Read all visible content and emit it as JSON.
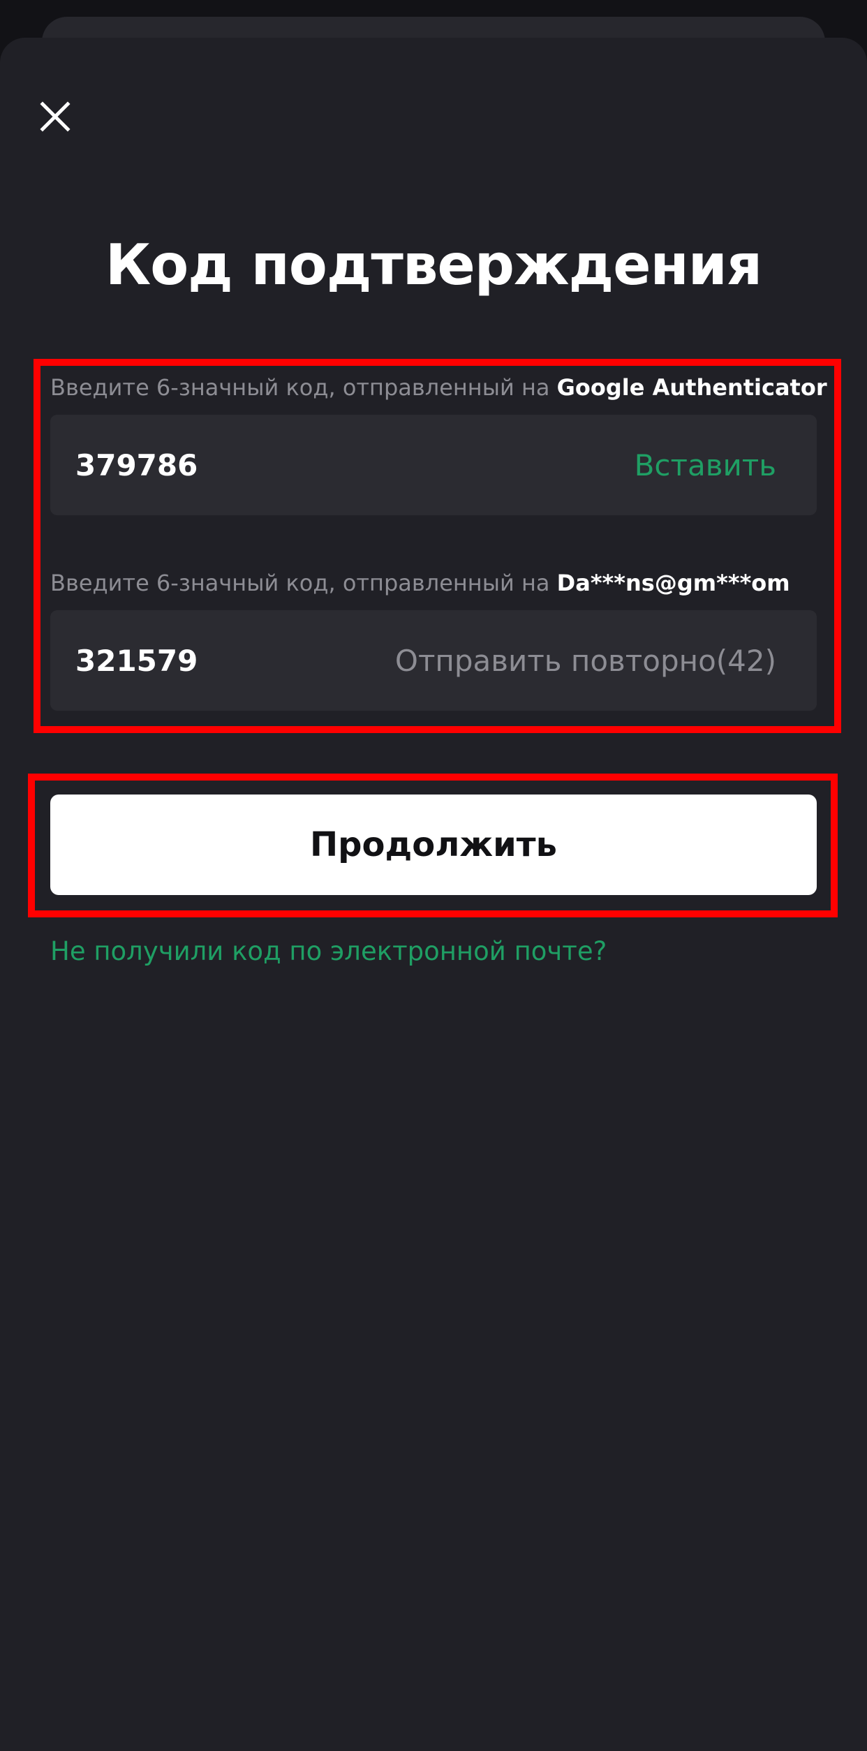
{
  "header": {
    "close_icon": "close-icon",
    "title": "Код подтверждения"
  },
  "authenticator": {
    "caption_prefix": "Введите 6-значный код, отправленный на",
    "caption_target": "Google Authenticator",
    "value": "379786",
    "action_label": "Вставить"
  },
  "email": {
    "caption_prefix": "Введите 6-значный код, отправленный на",
    "caption_target": "Da***ns@gm***om",
    "value": "321579",
    "resend_label": "Отправить повторно(42)"
  },
  "continue_label": "Продолжить",
  "help_link": "Не получили код по электронной почте?",
  "colors": {
    "background": "#202026",
    "field": "#2b2b31",
    "accent": "#1f9f64",
    "highlight": "#ff0000"
  }
}
